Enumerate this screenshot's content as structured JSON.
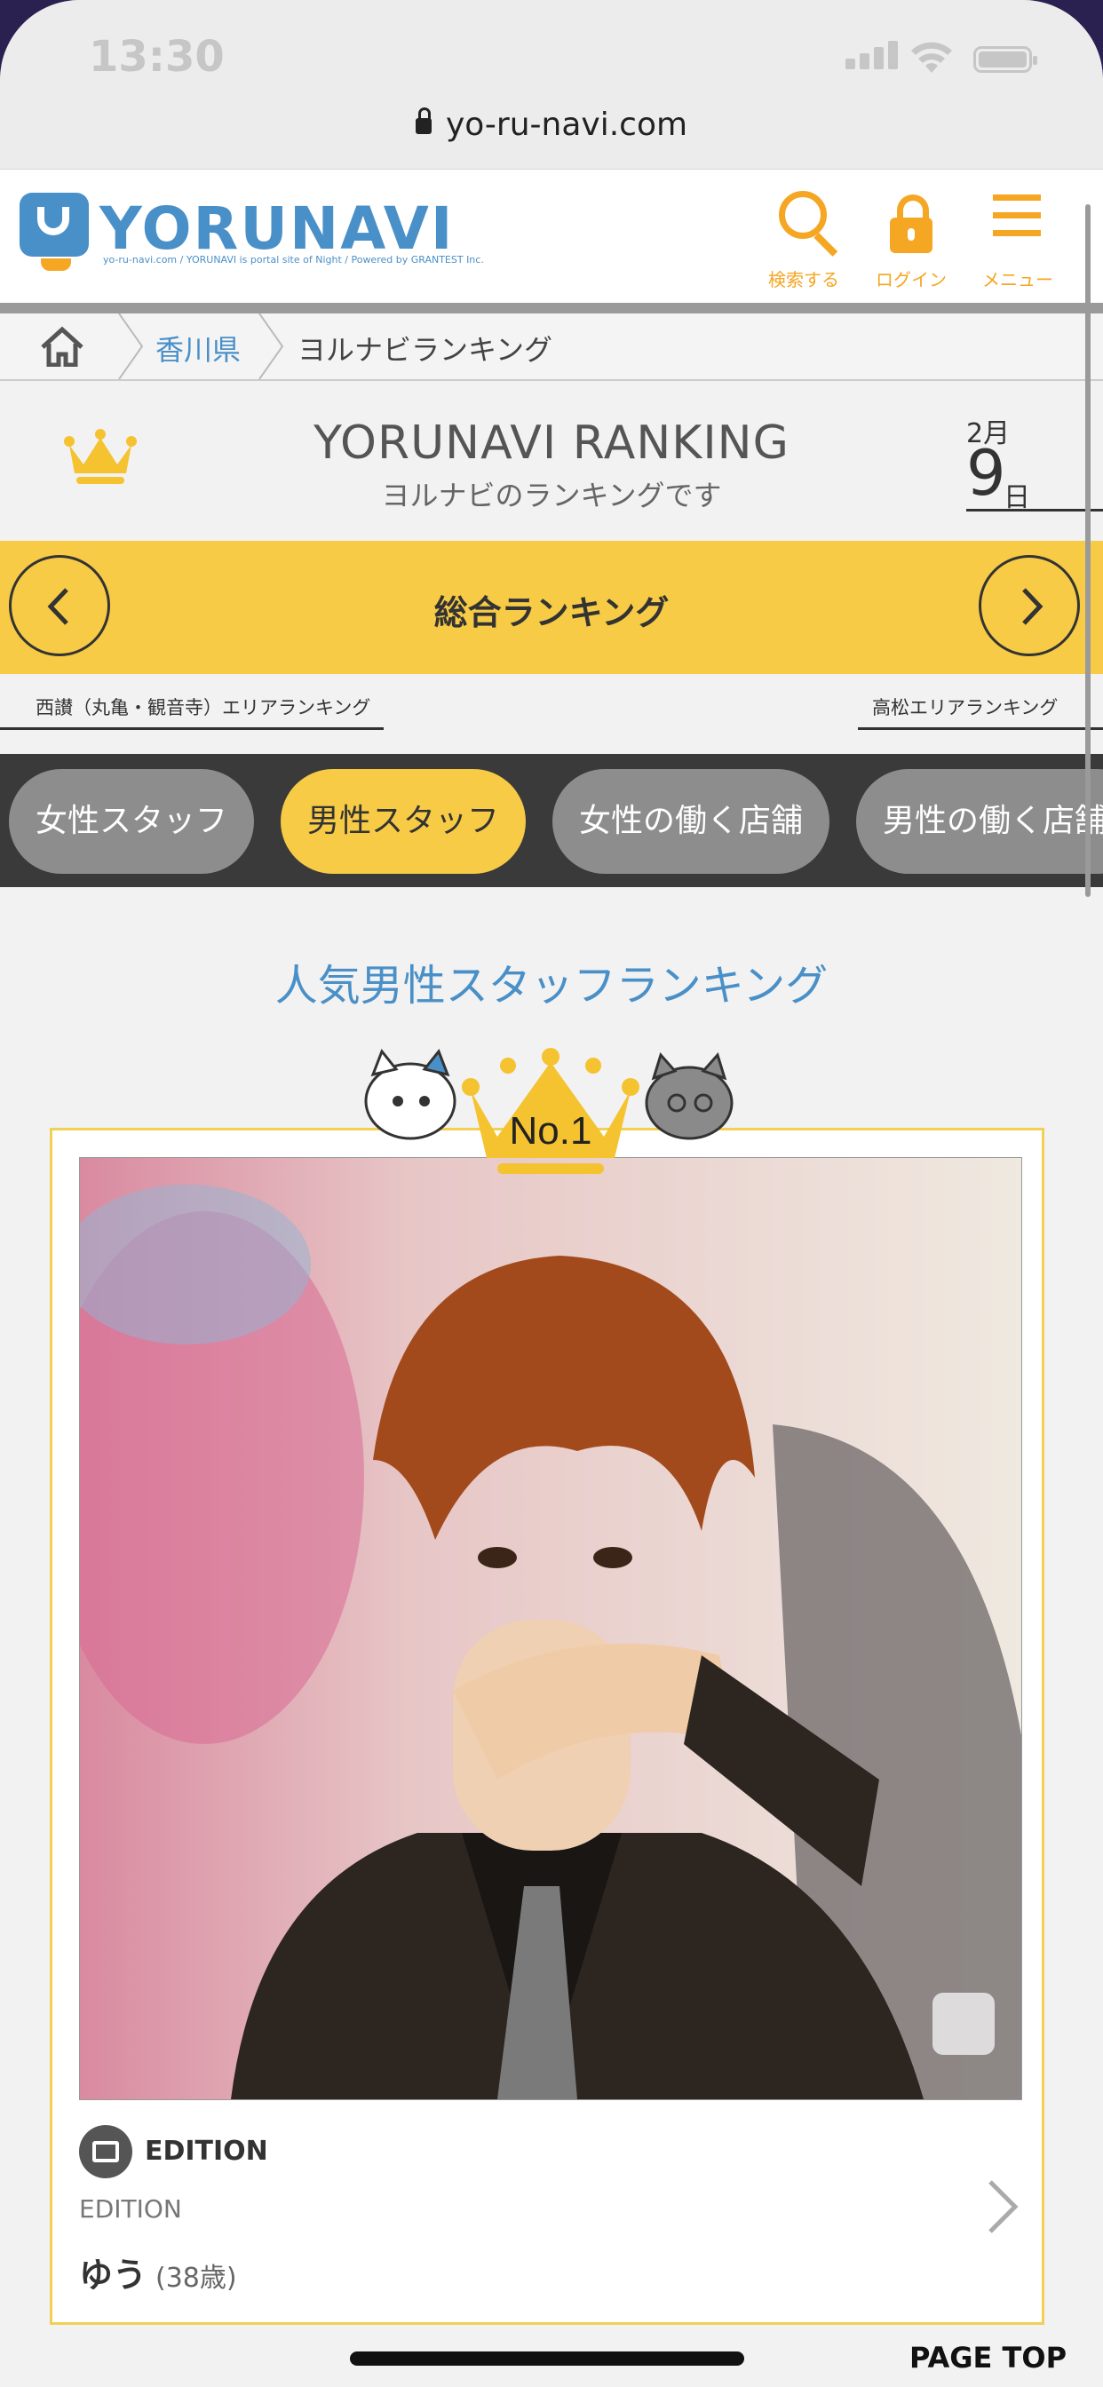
{
  "status": {
    "time": "13:30"
  },
  "browser": {
    "url": "yo-ru-navi.com"
  },
  "header": {
    "logo_text": "YORUNAVI",
    "logo_sub": "yo-ru-navi.com / YORUNAVI is portal site of Night / Powered by GRANTEST Inc.",
    "search_label": "検索する",
    "login_label": "ログイン",
    "menu_label": "メニュー",
    "accent": "#f5a623",
    "brand": "#4a90c8"
  },
  "breadcrumb": {
    "level1": "香川県",
    "level2": "ヨルナビランキング"
  },
  "ranking_header": {
    "title": "YORUNAVI RANKING",
    "subtitle": "ヨルナビのランキングです",
    "month": "2月",
    "day": "9",
    "day_unit": "日"
  },
  "ranking_bar": {
    "title": "総合ランキング",
    "color": "#f7cb45"
  },
  "area_links": {
    "left": "西讃（丸亀・観音寺）エリアランキング",
    "right": "高松エリアランキング"
  },
  "tabs": [
    {
      "label": "女性スタッフ"
    },
    {
      "label": "男性スタッフ"
    },
    {
      "label": "女性の働く店舗"
    },
    {
      "label": "男性の働く店舗"
    }
  ],
  "section_title": "人気男性スタッフランキング",
  "card": {
    "rank_label": "No.1",
    "shop_name": "EDITION",
    "shop_sub": "EDITION",
    "person_name": "ゆう",
    "person_age": "(38歳)"
  },
  "footer": {
    "page_top": "PAGE TOP"
  }
}
